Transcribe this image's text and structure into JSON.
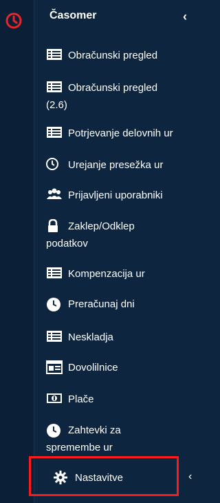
{
  "app": {
    "title": "Časomer",
    "collapse_glyph": "‹"
  },
  "colors": {
    "background": "#0e2540",
    "rail": "#0b1f37",
    "logo": "#e8262a",
    "highlight": "#ff1a1a",
    "text": "#ffffff"
  },
  "menu": {
    "items": [
      {
        "label": "Obračunski pregled",
        "icon": "table-icon"
      },
      {
        "label": "Obračunski pregled",
        "label2": "(2.6)",
        "icon": "table-icon"
      },
      {
        "label": "Potrjevanje delovnih ur",
        "icon": "table-icon"
      },
      {
        "label": "Urejanje presežka ur",
        "icon": "clock-icon"
      },
      {
        "label": "Prijavljeni uporabniki",
        "icon": "users-icon"
      },
      {
        "label": "Zaklep/Odklep",
        "label2": "podatkov",
        "icon": "lock-icon"
      },
      {
        "label": "Kompenzacija ur",
        "icon": "table-icon"
      },
      {
        "label": "Preračunaj dni",
        "icon": "clock-icon"
      },
      {
        "label": "Neskladja",
        "icon": "table-icon"
      },
      {
        "label": "Dovolilnice",
        "icon": "card-icon"
      },
      {
        "label": "Plače",
        "icon": "money-icon"
      },
      {
        "label": "Zahtevki za",
        "label2": "spremembe ur",
        "icon": "clock-icon"
      }
    ],
    "settings": {
      "label": "Nastavitve",
      "icon": "gear-icon",
      "chevron": "‹"
    }
  }
}
